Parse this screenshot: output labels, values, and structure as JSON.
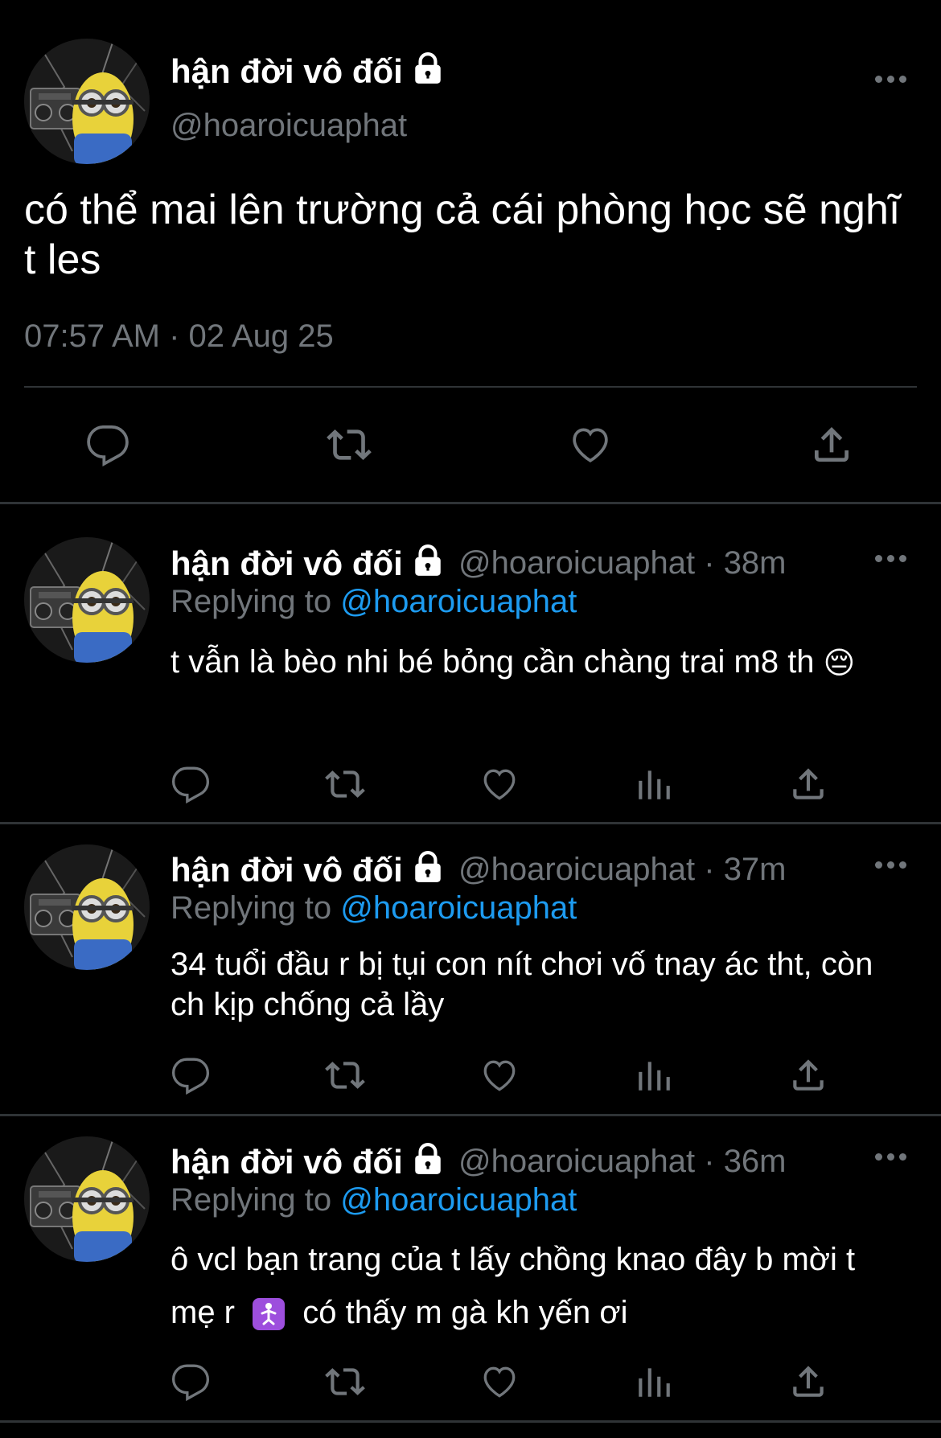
{
  "main_tweet": {
    "display_name": "hận đời vô đối",
    "handle": "@hoaroicuaphat",
    "text": "có thể mai lên trường cả cái phòng học sẽ nghĩ t les",
    "timestamp": "07:57 AM · 02 Aug 25"
  },
  "replies": [
    {
      "display_name": "hận đời vô đối",
      "handle_time": "@hoaroicuaphat · 38m",
      "replying_label": "Replying to",
      "replying_to": "@hoaroicuaphat",
      "text": "t vẫn là bèo nhi bé bỏng cần chàng trai m8 th",
      "emoji": "😔"
    },
    {
      "display_name": "hận đời vô đối",
      "handle_time": "@hoaroicuaphat · 37m",
      "replying_label": "Replying to",
      "replying_to": "@hoaroicuaphat",
      "text": "34 tuổi đầu r bị tụi con nít chơi vố tnay ác tht, còn ch kịp chống cả lầy"
    },
    {
      "display_name": "hận đời vô đối",
      "handle_time": "@hoaroicuaphat · 36m",
      "replying_label": "Replying to",
      "replying_to": "@hoaroicuaphat",
      "text_before": "ô vcl bạn trang của t lấy chồng knao đây b mời t mẹ r",
      "text_after": " có thấy m gà kh yến ơi"
    }
  ],
  "icons": [
    "reply-icon",
    "retweet-icon",
    "like-icon",
    "views-icon",
    "share-icon",
    "more-icon",
    "lock-icon"
  ],
  "colors": {
    "background": "#000000",
    "text": "#e7e9ea",
    "secondary": "#71767b",
    "accent": "#1d9bf0",
    "divider": "#2f3336"
  }
}
